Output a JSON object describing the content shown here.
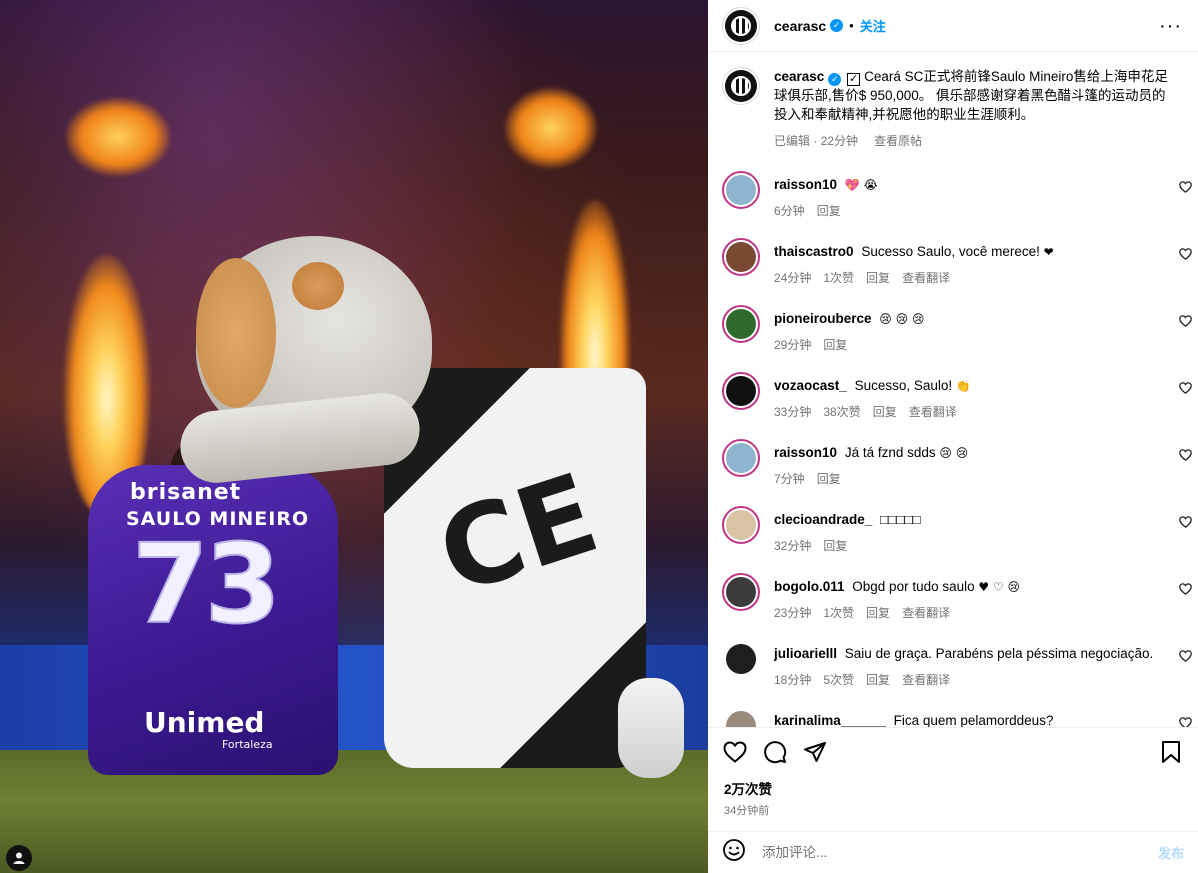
{
  "photo": {
    "jersey_sponsor": "brisanet",
    "jersey_name": "SAULO MINEIRO",
    "jersey_number": "73",
    "jersey_bottom": "Unimed",
    "jersey_bottom_sub": "Fortaleza",
    "vest_text": "CE"
  },
  "header": {
    "username": "cearasc",
    "follow_label": "关注",
    "dot": "•",
    "more": "···"
  },
  "caption": {
    "username": "cearasc",
    "text": "Ceará SC正式将前锋Saulo Mineiro售给上海申花足球俱乐部,售价$ 950,000。 俱乐部感谢穿着黑色醋斗篷的运动员的投入和奉献精神,并祝愿他的职业生涯顺利。",
    "edited": "已编辑 · 22分钟",
    "see_original": "查看原帖"
  },
  "comments": [
    {
      "user": "raisson10",
      "text": "",
      "emoji": "💖 😭",
      "time": "6分钟",
      "likes": "",
      "reply": "回复",
      "translate": "",
      "pic": "#8fb4cf"
    },
    {
      "user": "thaiscastro0",
      "text": "Sucesso Saulo, você merece!",
      "emoji": "❤",
      "time": "24分钟",
      "likes": "1次赞",
      "reply": "回复",
      "translate": "查看翻译",
      "pic": "#7a4a33"
    },
    {
      "user": "pioneirouberce",
      "text": "",
      "emoji": "😢 😢 😢",
      "time": "29分钟",
      "likes": "",
      "reply": "回复",
      "translate": "",
      "pic": "#2f6a2c"
    },
    {
      "user": "vozaocast_",
      "text": "Sucesso, Saulo!",
      "emoji": "👏",
      "time": "33分钟",
      "likes": "38次赞",
      "reply": "回复",
      "translate": "查看翻译",
      "pic": "#111111"
    },
    {
      "user": "raisson10",
      "text": "Já tá fznd sdds",
      "emoji": "😢 😢",
      "time": "7分钟",
      "likes": "",
      "reply": "回复",
      "translate": "",
      "pic": "#8fb4cf"
    },
    {
      "user": "clecioandrade_",
      "text": "□□□□□",
      "emoji": "",
      "time": "32分钟",
      "likes": "",
      "reply": "回复",
      "translate": "",
      "pic": "#d8c3a5"
    },
    {
      "user": "bogolo.011",
      "text": "Obgd por tudo saulo",
      "emoji": "♥ ♡ 😢",
      "time": "23分钟",
      "likes": "1次赞",
      "reply": "回复",
      "translate": "查看翻译",
      "pic": "#3b3b3b"
    },
    {
      "user": "julioarielll",
      "text": "Saiu de graça. Parabéns pela péssima negociação.",
      "emoji": "",
      "time": "18分钟",
      "likes": "5次赞",
      "reply": "回复",
      "translate": "查看翻译",
      "pic": "#1e1e1e"
    },
    {
      "user": "karinalima______",
      "text": "Fica quem pelamorddeus?",
      "emoji": "",
      "time": "",
      "likes": "",
      "reply": "",
      "translate": "",
      "pic": "#9a8c7c"
    }
  ],
  "actions": {
    "like_count": "2万次赞",
    "time_ago": "34分钟前"
  },
  "add_comment": {
    "placeholder": "添加评论...",
    "post_label": "发布"
  }
}
